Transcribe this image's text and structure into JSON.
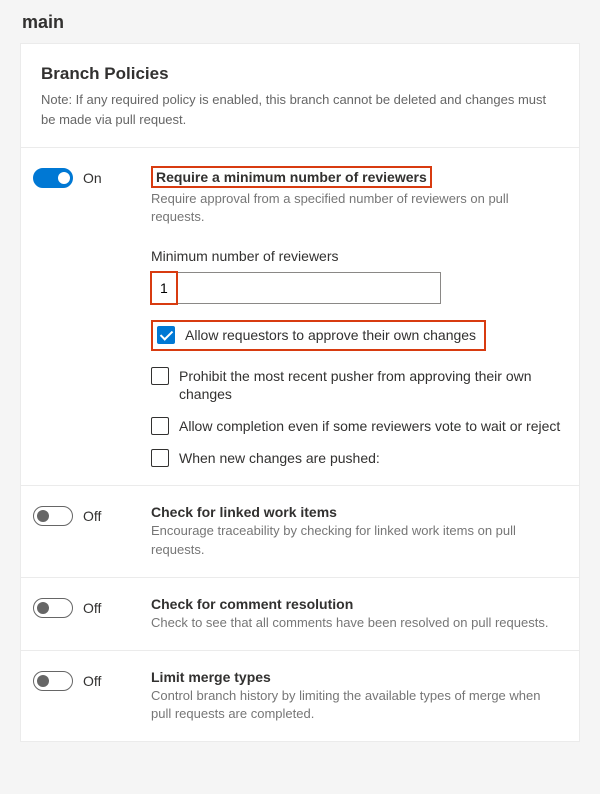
{
  "page_title": "main",
  "section_title": "Branch Policies",
  "section_note": "Note: If any required policy is enabled, this branch cannot be deleted and changes must be made via pull request.",
  "toggle_labels": {
    "on": "On",
    "off": "Off"
  },
  "policies": {
    "min_reviewers": {
      "title": "Require a minimum number of reviewers",
      "desc": "Require approval from a specified number of reviewers on pull requests.",
      "enabled": true,
      "field_label": "Minimum number of reviewers",
      "value": "1",
      "allow_requestors": {
        "checked": true,
        "label": "Allow requestors to approve their own changes"
      },
      "prohibit_recent_pusher": {
        "checked": false,
        "label": "Prohibit the most recent pusher from approving their own changes"
      },
      "allow_completion_wait_reject": {
        "checked": false,
        "label": "Allow completion even if some reviewers vote to wait or reject"
      },
      "when_new_changes": {
        "checked": false,
        "label": "When new changes are pushed:"
      }
    },
    "linked_work_items": {
      "title": "Check for linked work items",
      "desc": "Encourage traceability by checking for linked work items on pull requests.",
      "enabled": false
    },
    "comment_resolution": {
      "title": "Check for comment resolution",
      "desc": "Check to see that all comments have been resolved on pull requests.",
      "enabled": false
    },
    "limit_merge": {
      "title": "Limit merge types",
      "desc": "Control branch history by limiting the available types of merge when pull requests are completed.",
      "enabled": false
    }
  }
}
